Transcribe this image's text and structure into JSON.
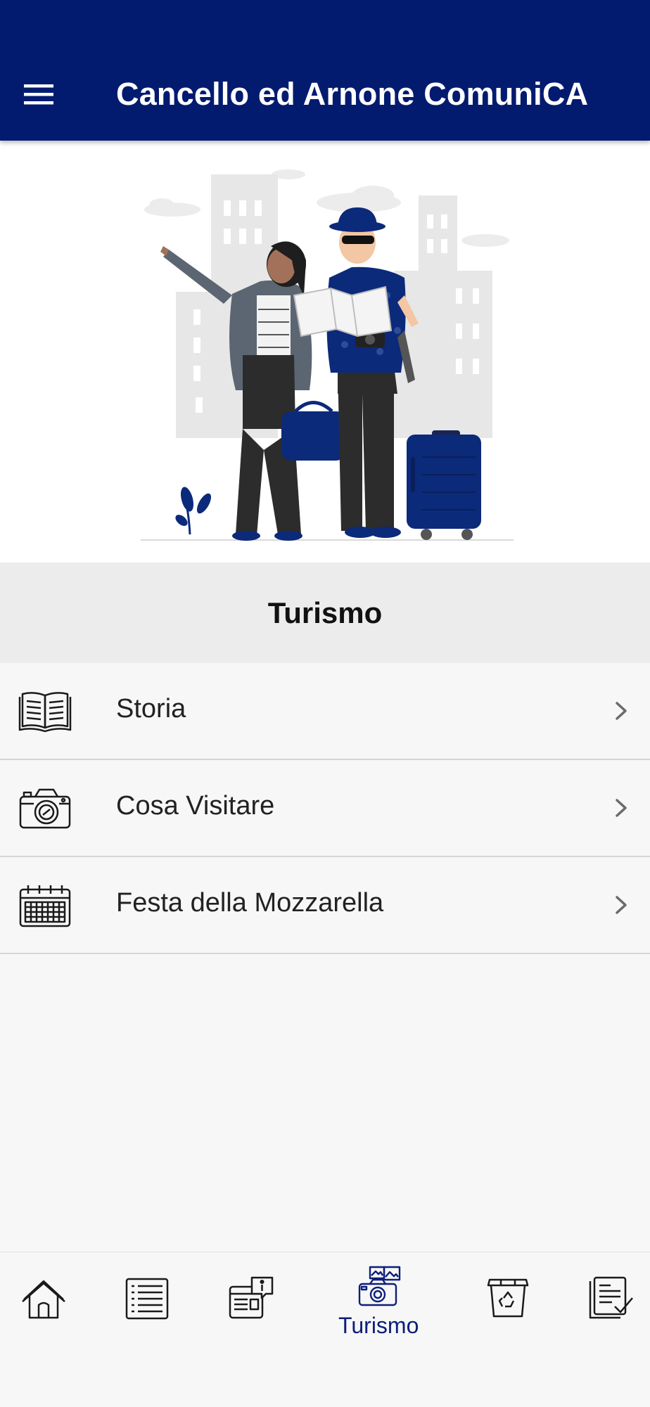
{
  "appbar": {
    "title": "Cancello ed Arnone ComuniCA",
    "menu_icon": "hamburger-menu-icon",
    "background_color": "#021b6f"
  },
  "hero": {
    "illustration": "tourists-with-map-illustration"
  },
  "section": {
    "title": "Turismo"
  },
  "list": {
    "items": [
      {
        "label": "Storia",
        "icon": "open-book-icon"
      },
      {
        "label": "Cosa Visitare",
        "icon": "camera-icon"
      },
      {
        "label": "Festa della Mozzarella",
        "icon": "calendar-icon"
      }
    ],
    "chevron_icon": "chevron-right-icon"
  },
  "bottom_nav": {
    "active_label": "Turismo",
    "active_color": "#0c1f7a",
    "items": [
      {
        "icon": "home-icon"
      },
      {
        "icon": "list-icon"
      },
      {
        "icon": "info-news-icon"
      },
      {
        "icon": "photo-camera-tourism-icon",
        "label": "Turismo",
        "active": true
      },
      {
        "icon": "recycle-bin-icon"
      },
      {
        "icon": "document-check-icon"
      }
    ]
  }
}
